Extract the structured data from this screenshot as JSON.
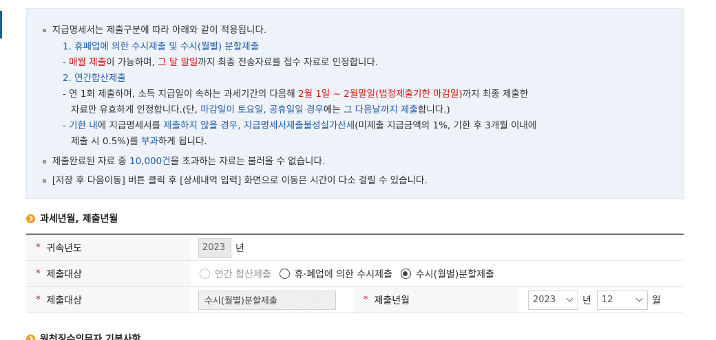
{
  "notice": {
    "line1": "지급명세서는 제출구분에 따라 아래와 같이 적용됩니다.",
    "item1_title": "1. 휴폐업에 의한 수시제출 및 수시(월별) 분할제출",
    "item1_a": "- ",
    "item1_b": "매월 제출",
    "item1_c": "이 가능하며, ",
    "item1_d": "그 달 말일",
    "item1_e": "까지 최종 전송자료를 접수 자료로 인정합니다.",
    "item2_title": "2. 연간합산제출",
    "item2_l1_a": "- 연 1회 제출하며, 소득 지급일이 속하는 과세기간의 다음해 ",
    "item2_l1_b": "2월 1일 ~ 2월말일(법정제출기한 마감일)",
    "item2_l1_c": "까지 최종 제출한",
    "item2_l2_a": "자료만 유효하게 인정합니다.(단, ",
    "item2_l2_b": "마감일이 토요일, 공휴일일 경우",
    "item2_l2_c": "에는 ",
    "item2_l2_d": "그 다음날까지 제출",
    "item2_l2_e": "합니다.)",
    "item2_l3_a": "- ",
    "item2_l3_b": "기한 내",
    "item2_l3_c": "에 지급명세서를 ",
    "item2_l3_d": "제출하지 않을 경우, 지급명세서제출불성실가산세",
    "item2_l3_e": "(미제출 지급금액의 1%, 기한 후 3개월 이내에",
    "item2_l4_a": "제출 시 0.5%)를 ",
    "item2_l4_b": "부과",
    "item2_l4_c": "하게 됩니다.",
    "line_limit_a": "제출완료된 자료 중 ",
    "line_limit_b": "10,000건",
    "line_limit_c": "을 초과하는 자료는 불러올 수 없습니다.",
    "line_move": "[저장 후 다음이동] 버튼 클릭 후 [상세내역 입력] 화면으로 이동은 시간이 다소 걸릴 수 있습니다."
  },
  "section1": {
    "title": "과세년월, 제출년월"
  },
  "section2": {
    "title": "원천징수의무자 기본사항"
  },
  "form": {
    "required_mark": "*",
    "row1": {
      "label": "귀속년도",
      "year_value": "2023",
      "unit": "년"
    },
    "row2": {
      "label": "제출대상",
      "options": [
        "연간 합산제출",
        "휴·폐업에 의한 수시제출",
        "수시(월별)분할제출"
      ],
      "selected": "수시(월별)분할제출"
    },
    "row3": {
      "label": "제출대상",
      "readonly_value": "수시(월별)분할제출",
      "label2": "제출년월",
      "year_value": "2023",
      "year_unit": "년",
      "month_value": "12",
      "month_unit": "월"
    }
  },
  "colors": {
    "accent_blue": "#1f5aa6",
    "accent_red": "#d01414",
    "required": "#c8102e",
    "section_icon": "#f0a020"
  },
  "icons": {
    "section": "circle-arrow-icon",
    "select": "chevron-down-icon"
  }
}
